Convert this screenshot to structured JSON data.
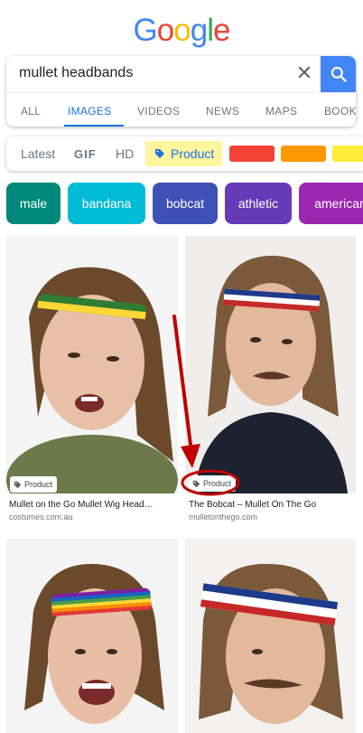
{
  "logo": {
    "letters": [
      "G",
      "o",
      "o",
      "g",
      "l",
      "e"
    ],
    "colors": [
      "#4285f4",
      "#ea4335",
      "#fbbc05",
      "#4285f4",
      "#34a853",
      "#ea4335"
    ]
  },
  "search": {
    "query": "mullet headbands",
    "clear_icon": "close-icon",
    "search_icon": "search-icon"
  },
  "tabs": [
    {
      "label": "ALL"
    },
    {
      "label": "IMAGES",
      "active": true
    },
    {
      "label": "VIDEOS"
    },
    {
      "label": "NEWS"
    },
    {
      "label": "MAPS"
    },
    {
      "label": "BOOK"
    }
  ],
  "filters": {
    "latest": "Latest",
    "gif": "GIF",
    "hd": "HD",
    "product": "Product",
    "product_icon": "tag-icon",
    "color_swatches": [
      "#f44336",
      "#ff9800",
      "#ffeb3b"
    ]
  },
  "related_chips": [
    {
      "label": "male",
      "color": "#00897b"
    },
    {
      "label": "bandana",
      "color": "#00bcd4"
    },
    {
      "label": "bobcat",
      "color": "#3f51b5"
    },
    {
      "label": "athletic",
      "color": "#673ab7"
    },
    {
      "label": "american",
      "color": "#9c27b0"
    }
  ],
  "results": [
    {
      "badge": "Product",
      "title": "Mullet on the Go Mullet Wig Head…",
      "source": "costumes.com.au",
      "band_colors": [
        "#2e7d32",
        "#fdd835",
        "#2e7d32"
      ]
    },
    {
      "badge": "Product",
      "title": "The Bobcat – Mullet On The Go",
      "source": "mulletonthego.com",
      "band_colors": [
        "#1e3a8a",
        "#ffffff",
        "#c62828"
      ]
    },
    {
      "badge": "",
      "title": "",
      "source": "",
      "band_colors": [
        "#7b1fa2",
        "#1565c0",
        "#43a047",
        "#fdd835",
        "#fb8c00",
        "#e53935"
      ]
    },
    {
      "badge": "",
      "title": "",
      "source": "",
      "band_colors": [
        "#1e3a8a",
        "#ffffff",
        "#c62828"
      ]
    }
  ],
  "annotation": {
    "color": "#c00000"
  }
}
